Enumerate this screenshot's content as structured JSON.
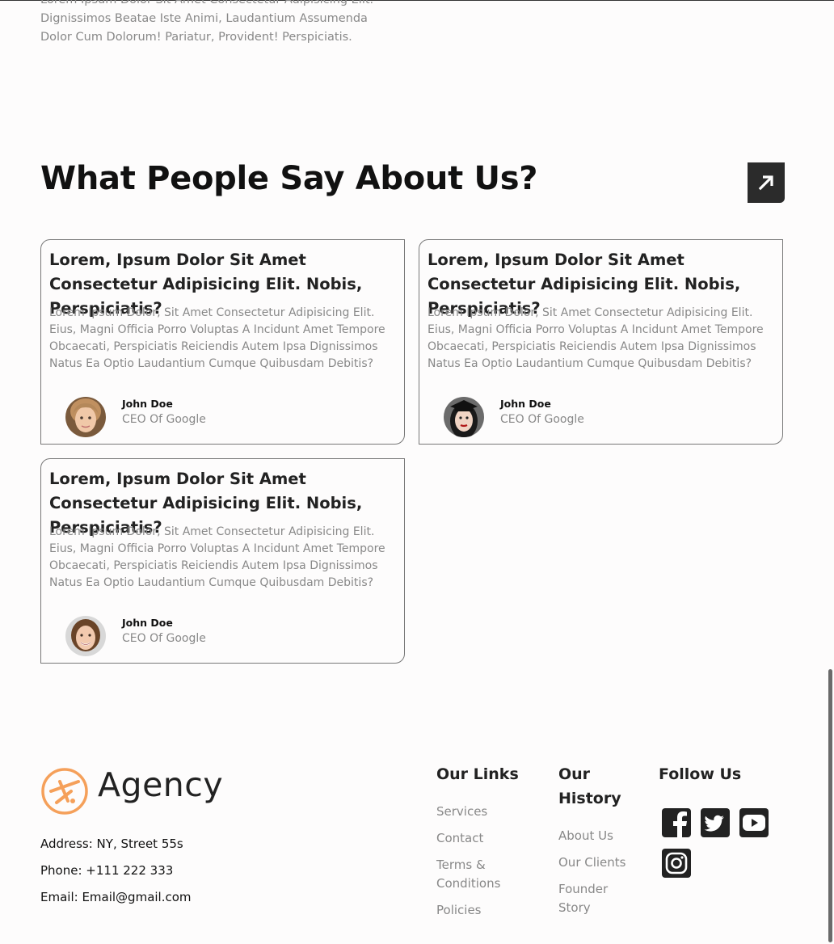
{
  "intro": {
    "lines": [
      "Lorem Ipsum Dolor Sit Amet Consectetur Adipisicing Elit.",
      "Dignissimos Beatae Iste Animi, Laudantium Assumenda",
      "Dolor Cum Dolorum! Pariatur, Provident! Perspiciatis."
    ]
  },
  "testimonials": {
    "title": "What People Say About Us?",
    "arrow_icon": "arrow-up-right-icon",
    "cards": [
      {
        "title": "Lorem, Ipsum Dolor Sit Amet Consectetur Adipisicing Elit. Nobis, Perspiciatis?",
        "body": "Lorem Ipsum Dolor, Sit Amet Consectetur Adipisicing Elit. Eius, Magni Officia Porro Voluptas A Incidunt Amet Tempore Obcaecati, Perspiciatis Reiciendis Autem Ipsa Dignissimos Natus Ea Optio Laudantium Cumque Quibusdam Debitis?",
        "name": "John Doe",
        "role": "CEO Of Google"
      },
      {
        "title": "Lorem, Ipsum Dolor Sit Amet Consectetur Adipisicing Elit. Nobis, Perspiciatis?",
        "body": "Lorem Ipsum Dolor, Sit Amet Consectetur Adipisicing Elit. Eius, Magni Officia Porro Voluptas A Incidunt Amet Tempore Obcaecati, Perspiciatis Reiciendis Autem Ipsa Dignissimos Natus Ea Optio Laudantium Cumque Quibusdam Debitis?",
        "name": "John Doe",
        "role": "CEO Of Google"
      },
      {
        "title": "Lorem, Ipsum Dolor Sit Amet Consectetur Adipisicing Elit. Nobis, Perspiciatis?",
        "body": "Lorem Ipsum Dolor, Sit Amet Consectetur Adipisicing Elit. Eius, Magni Officia Porro Voluptas A Incidunt Amet Tempore Obcaecati, Perspiciatis Reiciendis Autem Ipsa Dignissimos Natus Ea Optio Laudantium Cumque Quibusdam Debitis?",
        "name": "John Doe",
        "role": "CEO Of Google"
      }
    ]
  },
  "footer": {
    "brand": "Agency",
    "logo_color": "#f5a05a",
    "address": "Address: NY, Street 55s",
    "phone": "Phone: +111 222 333",
    "email": "Email: Email@gmail.com",
    "links_title": "Our Links",
    "links": [
      "Services",
      "Contact",
      "Terms & Conditions",
      "Policies"
    ],
    "history_title": "Our History",
    "history": [
      "About Us",
      "Our Clients",
      "Founder Story"
    ],
    "follow_title": "Follow Us",
    "socials": [
      "facebook-icon",
      "twitter-icon",
      "youtube-icon",
      "instagram-icon"
    ]
  },
  "colors": {
    "background": "#fdfcfc",
    "dark": "#2b2b2b",
    "muted_text": "#888888",
    "accent": "#f5a05a"
  }
}
